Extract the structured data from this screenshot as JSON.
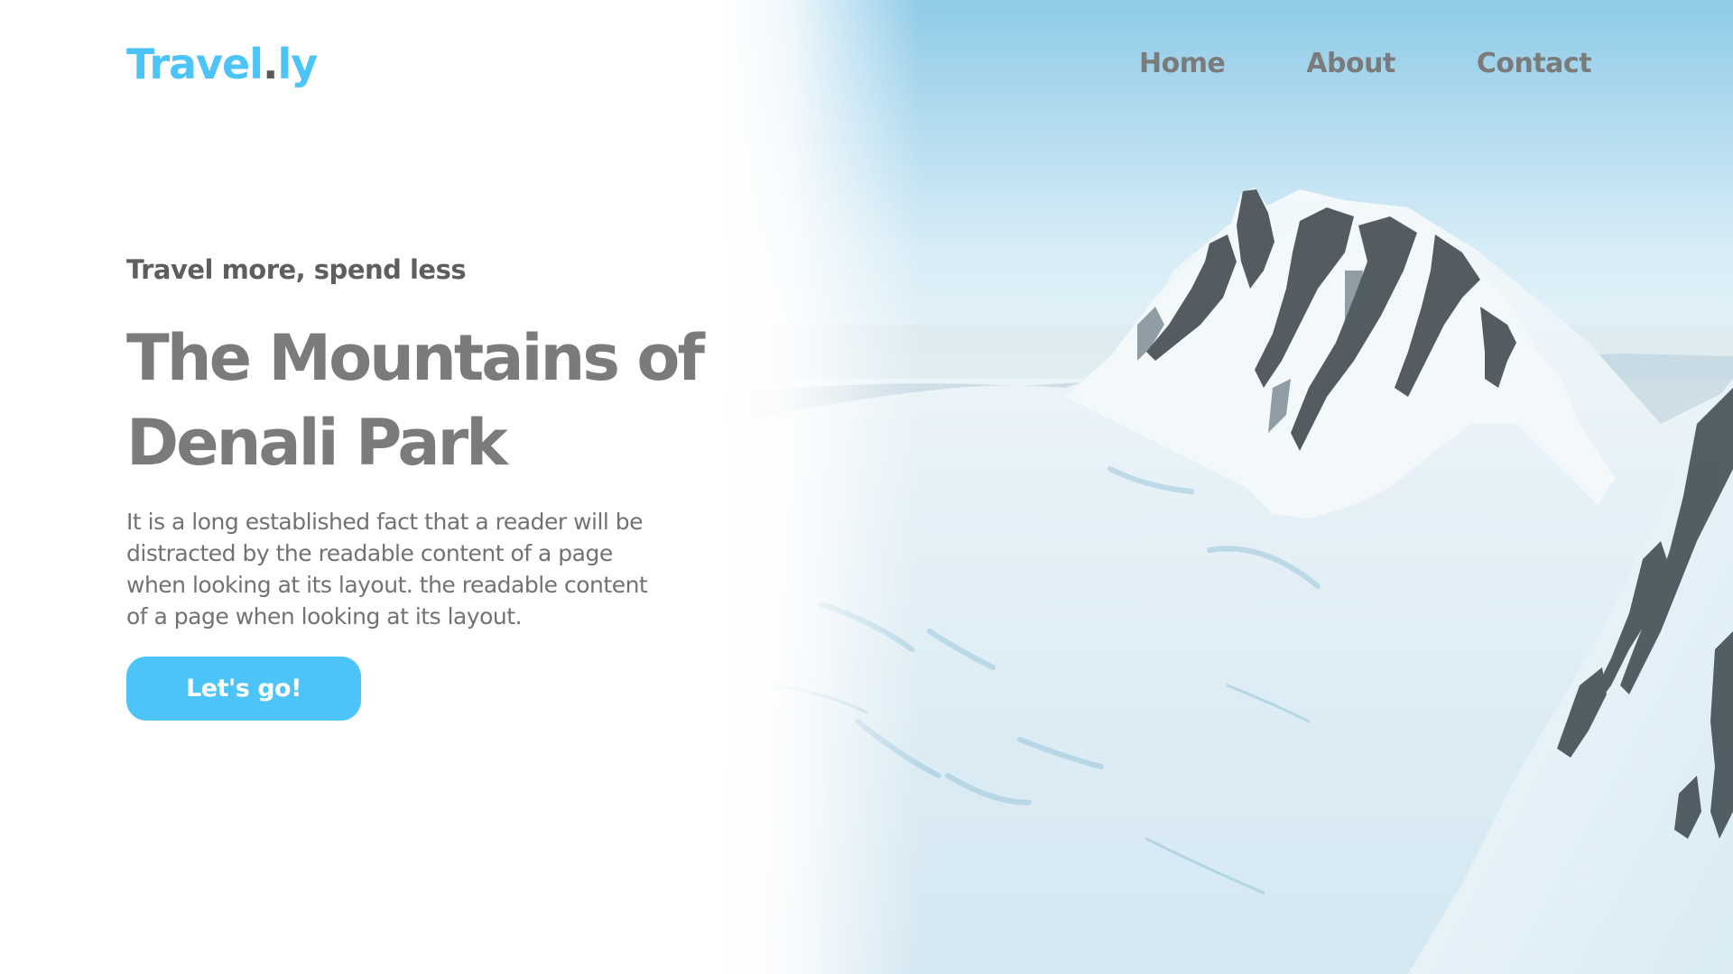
{
  "brand": {
    "name_main": "Travel",
    "name_dot": ".",
    "name_suffix": "ly",
    "accent_color": "#4cc4f7"
  },
  "nav": {
    "items": [
      {
        "label": "Home"
      },
      {
        "label": "About"
      },
      {
        "label": "Contact"
      }
    ]
  },
  "hero": {
    "tagline": "Travel more, spend less",
    "headline_line1": "The Mountains of",
    "headline_line2": "Denali Park",
    "description": "It is a long established fact that a reader will be distracted by the readable content of a page when looking at its layout. the readable content of a page when looking at its layout.",
    "cta_label": "Let's go!",
    "image": "snowy-mountain-peak-photo"
  },
  "colors": {
    "text_gray": "#7b7b7b",
    "button_bg": "#4cc4f7",
    "button_text": "#ffffff"
  }
}
